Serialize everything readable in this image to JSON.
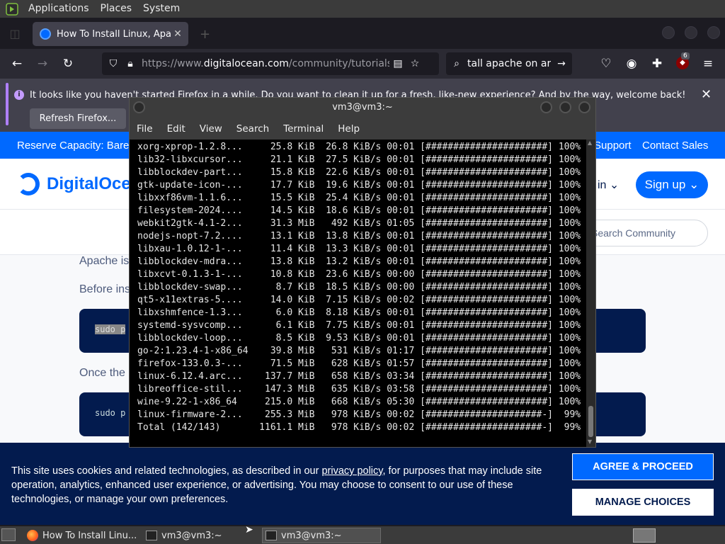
{
  "top_panel": {
    "menus": [
      "Applications",
      "Places",
      "System"
    ]
  },
  "firefox": {
    "tab_title": "How To Install Linux, Apache",
    "url_prefix": "https://www.",
    "url_domain": "digitalocean.com",
    "url_path": "/community/tutorials/how",
    "search_text": "tall apache on arch",
    "extension_badge": "6",
    "notification_message": "It looks like you haven't started Firefox in a while. Do you want to clean it up for a fresh, like-new experience? And by the way, welcome back!",
    "refresh_button": "Refresh Firefox..."
  },
  "page": {
    "promo_left": "Reserve Capacity: Bare",
    "promo_support": "Support",
    "promo_contact": "Contact Sales",
    "brand": "DigitalOcean",
    "login": "in",
    "signup": "Sign up",
    "community_search_placeholder": "Search Community",
    "para1": "Apache is",
    "para2": "Before ins",
    "code1": "sudo p",
    "para3": "Once the",
    "code2": "sudo p",
    "cookie_text_1": "This site uses cookies and related technologies, as described in our ",
    "cookie_link": "privacy policy",
    "cookie_text_2": ", for purposes that may include site operation, analytics, enhanced user experience, or advertising. You may choose to consent to our use of these technologies, or manage your own preferences.",
    "agree_button": "AGREE & PROCEED",
    "manage_button": "MANAGE CHOICES"
  },
  "terminal": {
    "title": "vm3@vm3:~",
    "menu": [
      "File",
      "Edit",
      "View",
      "Search",
      "Terminal",
      "Help"
    ],
    "lines": [
      "xorg-xprop-1.2.8...     25.8 KiB  26.8 KiB/s 00:01 [######################] 100%",
      "lib32-libxcursor...     21.1 KiB  27.5 KiB/s 00:01 [######################] 100%",
      "libblockdev-part...     15.8 KiB  22.6 KiB/s 00:01 [######################] 100%",
      "gtk-update-icon-...     17.7 KiB  19.6 KiB/s 00:01 [######################] 100%",
      "libxxf86vm-1.1.6...     15.5 KiB  25.4 KiB/s 00:01 [######################] 100%",
      "filesystem-2024....     14.5 KiB  18.6 KiB/s 00:01 [######################] 100%",
      "webkit2gtk-4.1-2...     31.3 MiB   492 KiB/s 01:05 [######################] 100%",
      "nodejs-nopt-7.2....     13.1 KiB  13.8 KiB/s 00:01 [######################] 100%",
      "libxau-1.0.12-1-...     11.4 KiB  13.3 KiB/s 00:01 [######################] 100%",
      "libblockdev-mdra...     13.8 KiB  13.2 KiB/s 00:01 [######################] 100%",
      "libxcvt-0.1.3-1-...     10.8 KiB  23.6 KiB/s 00:00 [######################] 100%",
      "libblockdev-swap...      8.7 KiB  18.5 KiB/s 00:00 [######################] 100%",
      "qt5-x11extras-5....     14.0 KiB  7.15 KiB/s 00:02 [######################] 100%",
      "libxshmfence-1.3...      6.0 KiB  8.18 KiB/s 00:01 [######################] 100%",
      "systemd-sysvcomp...      6.1 KiB  7.75 KiB/s 00:01 [######################] 100%",
      "libblockdev-loop...      8.5 KiB  9.53 KiB/s 00:01 [######################] 100%",
      "go-2:1.23.4-1-x86_64    39.8 MiB   531 KiB/s 01:17 [######################] 100%",
      "firefox-133.0.3-...     71.5 MiB   628 KiB/s 01:57 [######################] 100%",
      "linux-6.12.4.arc...    137.7 MiB   658 KiB/s 03:34 [######################] 100%",
      "libreoffice-stil...    147.3 MiB   635 KiB/s 03:58 [######################] 100%",
      "wine-9.22-1-x86_64     215.0 MiB   668 KiB/s 05:30 [######################] 100%",
      "linux-firmware-2...    255.3 MiB   978 KiB/s 00:02 [#####################-]  99%",
      "Total (142/143)       1161.1 MiB   978 KiB/s 00:02 [#####################-]  99%"
    ]
  },
  "taskbar": {
    "tasks": [
      "How To Install Linu...",
      "vm3@vm3:~",
      "vm3@vm3:~"
    ]
  },
  "colors": {
    "brand_blue": "#0069ff",
    "navy": "#031b4e",
    "firefox_dark": "#2b2a33"
  }
}
